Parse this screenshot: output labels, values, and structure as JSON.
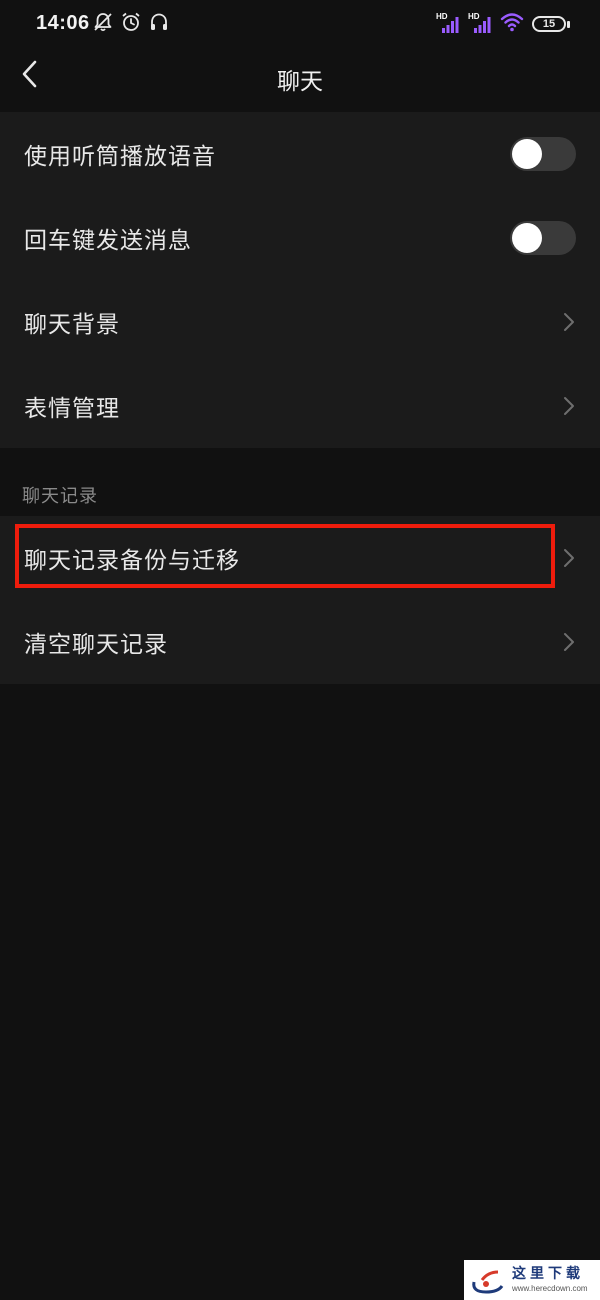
{
  "status_bar": {
    "time": "14:06",
    "left_icons": [
      "bell-off-icon",
      "alarm-clock-icon",
      "headset-icon"
    ],
    "signal_1_label": "HD",
    "signal_2_label": "HD",
    "battery": "15",
    "signal_color": "#9a5cff",
    "wifi_color": "#9a5cff"
  },
  "nav": {
    "back_icon": "chevron-left-icon",
    "title": "聊天"
  },
  "settings": {
    "items": [
      {
        "label": "使用听筒播放语音",
        "control": "toggle",
        "on": false
      },
      {
        "label": "回车键发送消息",
        "control": "toggle",
        "on": false
      },
      {
        "label": "聊天背景",
        "control": "chevron"
      },
      {
        "label": "表情管理",
        "control": "chevron"
      }
    ]
  },
  "chat_history": {
    "header": "聊天记录",
    "items": [
      {
        "label": "聊天记录备份与迁移",
        "control": "chevron",
        "highlighted": true
      },
      {
        "label": "清空聊天记录",
        "control": "chevron"
      }
    ]
  },
  "watermark": {
    "logo_text": "这里下载",
    "url": "www.herecdown.com"
  },
  "colors": {
    "background": "#111111",
    "section_bg": "#1b1b1b",
    "highlight": "#ee1c0c",
    "toggle_off": "#3a3a3a"
  }
}
